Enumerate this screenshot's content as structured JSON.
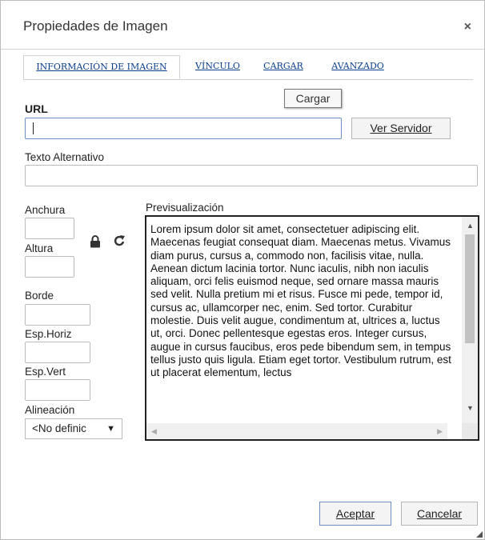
{
  "dialog": {
    "title": "Propiedades de Imagen",
    "close_symbol": "×"
  },
  "tabs": [
    {
      "label": "INFORMACIÓN DE IMAGEN",
      "active": true
    },
    {
      "label": "VÍNCULO",
      "active": false
    },
    {
      "label": "CARGAR",
      "active": false
    },
    {
      "label": "AVANZADO",
      "active": false
    }
  ],
  "url": {
    "label": "URL",
    "value": "",
    "browse_button": "Ver Servidor",
    "tooltip": "Cargar"
  },
  "alt_text": {
    "label": "Texto Alternativo",
    "value": ""
  },
  "dimensions": {
    "width_label": "Anchura",
    "width_value": "",
    "height_label": "Altura",
    "height_value": "",
    "lock_icon": "lock-icon",
    "reset_icon": "reset-size-icon"
  },
  "border": {
    "label": "Borde",
    "value": ""
  },
  "hspace": {
    "label": "Esp.Horiz",
    "value": ""
  },
  "vspace": {
    "label": "Esp.Vert",
    "value": ""
  },
  "alignment": {
    "label": "Alineación",
    "selected": "<No definic",
    "arrow": "▼"
  },
  "preview": {
    "label": "Previsualización",
    "text": "Lorem ipsum dolor sit amet, consectetuer adipiscing elit. Maecenas feugiat consequat diam. Maecenas metus. Vivamus diam purus, cursus a, commodo non, facilisis vitae, nulla. Aenean dictum lacinia tortor. Nunc iaculis, nibh non iaculis aliquam, orci felis euismod neque, sed ornare massa mauris sed velit. Nulla pretium mi et risus. Fusce mi pede, tempor id, cursus ac, ullamcorper nec, enim. Sed tortor. Curabitur molestie. Duis velit augue, condimentum at, ultrices a, luctus ut, orci. Donec pellentesque egestas eros. Integer cursus, augue in cursus faucibus, eros pede bibendum sem, in tempus tellus justo quis ligula. Etiam eget tortor. Vestibulum rutrum, est ut placerat elementum, lectus"
  },
  "footer": {
    "ok_button": "Aceptar",
    "cancel_button": "Cancelar"
  },
  "colors": {
    "tab_link": "#0a3e8e",
    "focus_border": "#6a8fc7",
    "border": "#bcbcbc"
  }
}
